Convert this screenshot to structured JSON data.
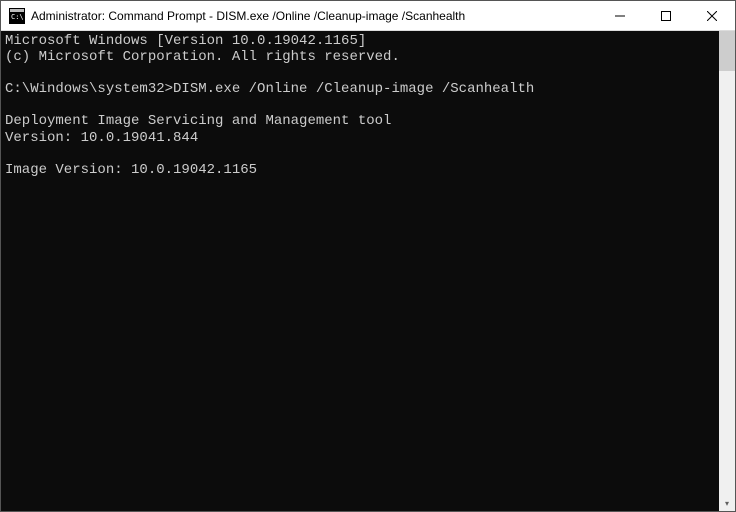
{
  "window": {
    "title": "Administrator: Command Prompt - DISM.exe  /Online /Cleanup-image /Scanhealth"
  },
  "terminal": {
    "line1": "Microsoft Windows [Version 10.0.19042.1165]",
    "line2": "(c) Microsoft Corporation. All rights reserved.",
    "blank1": "",
    "prompt": "C:\\Windows\\system32>DISM.exe /Online /Cleanup-image /Scanhealth",
    "blank2": "",
    "tool1": "Deployment Image Servicing and Management tool",
    "tool2": "Version: 10.0.19041.844",
    "blank3": "",
    "image_version": "Image Version: 10.0.19042.1165"
  }
}
